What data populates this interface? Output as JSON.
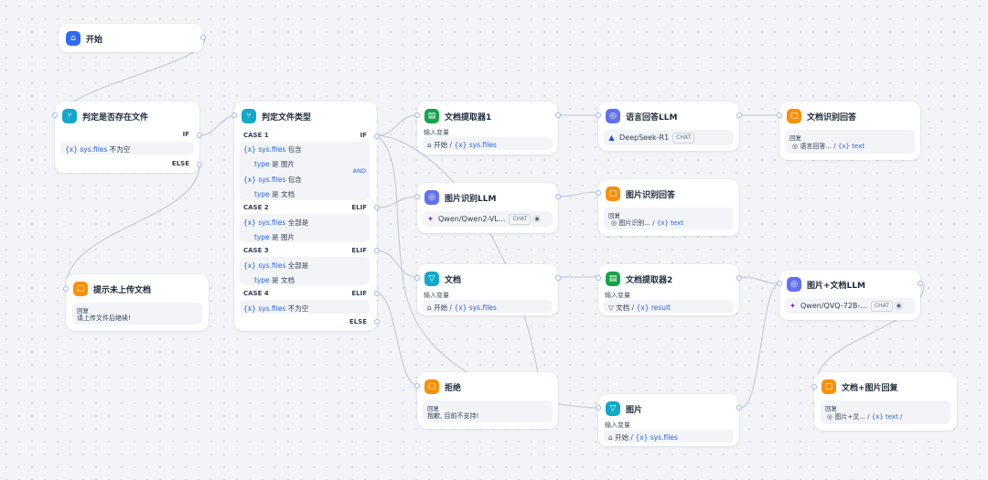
{
  "nodes": {
    "start": {
      "title": "开始"
    },
    "check_exists": {
      "title": "判定是否存在文件",
      "if_label": "IF",
      "cond_var": "{x} sys.files",
      "cond_op": "不为空",
      "else_label": "ELSE"
    },
    "file_type": {
      "title": "判定文件类型",
      "case1": "CASE 1",
      "case1_kw": "IF",
      "c1_a_var": "{x} sys.files",
      "c1_a_op": "包含",
      "c1_b_key": "type",
      "c1_b_is": "是",
      "c1_b_val": "图片",
      "and_label": "AND",
      "c1_c_var": "{x} sys.files",
      "c1_c_op": "包含",
      "c1_d_key": "type",
      "c1_d_is": "是",
      "c1_d_val": "文档",
      "case2": "CASE 2",
      "case2_kw": "ELIF",
      "c2_a_var": "{x} sys.files",
      "c2_a_op": "全部是",
      "c2_b_key": "type",
      "c2_b_is": "是",
      "c2_b_val": "图片",
      "case3": "CASE 3",
      "case3_kw": "ELIF",
      "c3_a_var": "{x} sys.files",
      "c3_a_op": "全部是",
      "c3_b_key": "type",
      "c3_b_is": "是",
      "c3_b_val": "文档",
      "case4": "CASE 4",
      "case4_kw": "ELIF",
      "c4_a_var": "{x} sys.files",
      "c4_a_op": "不为空",
      "else_label": "ELSE"
    },
    "no_file": {
      "title": "提示未上传文档",
      "reply_label": "回复",
      "reply_text": "请上传文件后继续!"
    },
    "doc_extract1": {
      "title": "文档提取器1",
      "input_label": "输入变量",
      "src": "开始",
      "var": "{x} sys.files"
    },
    "lang_llm": {
      "title": "语言回答LLM",
      "model": "DeepSeek-R1",
      "tag": "CHAT"
    },
    "doc_answer": {
      "title": "文档识别回答",
      "reply_label": "回复",
      "src": "语言回答...",
      "var": "{x} text"
    },
    "img_llm": {
      "title": "图片识别LLM",
      "model": "Qwen/Qwen2-VL...",
      "tag": "CHAT"
    },
    "img_answer": {
      "title": "图片识别回答",
      "reply_label": "回复",
      "src": "图片识别...",
      "var": "{x} text"
    },
    "doc_list": {
      "title": "文档",
      "input_label": "输入变量",
      "src": "开始",
      "var": "{x} sys.files"
    },
    "doc_extract2": {
      "title": "文档提取器2",
      "input_label": "输入变量",
      "src": "文档",
      "var": "{x} result"
    },
    "imgdoc_llm": {
      "title": "图片+文档LLM",
      "model": "Qwen/QVQ-72B-...",
      "tag": "CHAT"
    },
    "reject": {
      "title": "拒绝",
      "reply_label": "回复",
      "reply_text": "抱歉, 目前不支持!"
    },
    "img_list": {
      "title": "图片",
      "input_label": "输入变量",
      "src": "开始",
      "var": "{x} sys.files"
    },
    "imgdoc_reply": {
      "title": "文档+图片回复",
      "reply_label": "回复",
      "src": "图片+文...",
      "var": "{x} text",
      "slash": "/"
    }
  },
  "icons": {
    "start": "home-icon",
    "if_else": "branch-icon",
    "doc_extractor": "doc-extractor-icon",
    "llm": "brain-icon",
    "answer": "answer-icon",
    "list_filter": "filter-icon"
  },
  "colors": {
    "background": "#f2f4f7",
    "edge": "#c7cdd6",
    "handle": "#9db4ff",
    "variable": "#2563eb",
    "start_icon": "#2e6bf0",
    "if_else_icon": "#12a8c9",
    "extractor_icon": "#16a34a",
    "llm_icon": "#6170f2",
    "answer_icon": "#f79009"
  }
}
